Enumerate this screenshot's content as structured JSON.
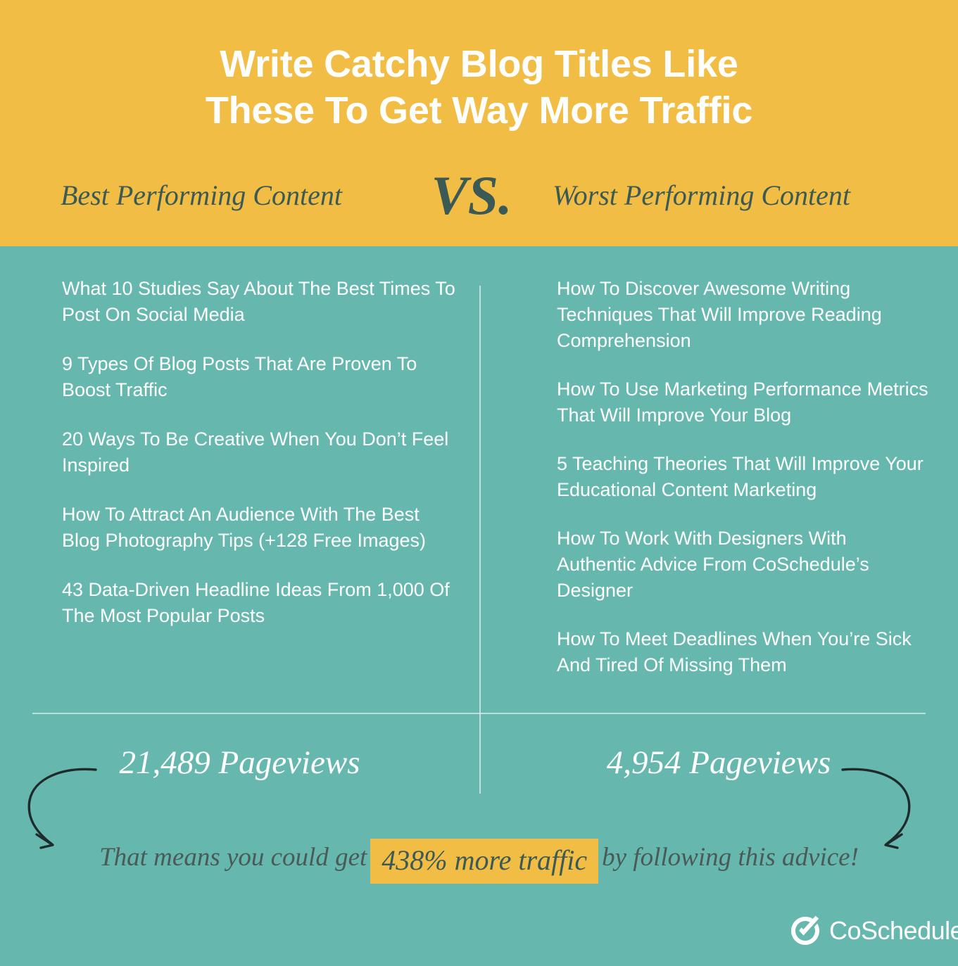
{
  "colors": {
    "header_bg": "#f2bd44",
    "body_bg": "#66b8ae",
    "title_text": "#ffffff",
    "accent_dark": "#3c5a55",
    "divider": "#ddeeeb",
    "highlight_bg": "#f2bd44",
    "statement_text": "#4a5a57",
    "arrow": "#1f2b2b"
  },
  "header": {
    "title_line1": "Write Catchy Blog Titles Like",
    "title_line2": "These To Get Way More Traffic",
    "left_label": "Best Performing Content",
    "vs_label": "VS.",
    "right_label": "Worst Performing Content"
  },
  "columns": {
    "best": {
      "items": [
        "What 10 Studies Say About The Best Times To Post On Social Media",
        "9 Types Of Blog Posts That Are Proven To Boost Traffic",
        "20 Ways To Be Creative When You Don’t Feel Inspired",
        "How To Attract An Audience With The Best Blog Photography Tips (+128 Free Images)",
        "43 Data-Driven Headline Ideas From 1,000 Of The Most Popular Posts"
      ],
      "pageviews": "21,489 Pageviews"
    },
    "worst": {
      "items": [
        "How To Discover Awesome Writing Techniques That Will Improve Reading Comprehension",
        "How To Use Marketing Performance Metrics That Will Improve Your Blog",
        "5 Teaching Theories That Will Improve Your Educational Content Marketing",
        "How To Work With Designers With Authentic Advice From CoSchedule’s Designer",
        "How To Meet Deadlines When You’re Sick And Tired Of Missing Them"
      ],
      "pageviews": "4,954 Pageviews"
    }
  },
  "statement": {
    "prefix": "That means you could get",
    "highlight": "438% more traffic",
    "suffix": "by following this advice!"
  },
  "footer": {
    "logo_text": "CoSchedule",
    "logo_icon": "check-circle-icon"
  },
  "chart_data": {
    "type": "bar",
    "title": "Write Catchy Blog Titles Like These To Get Way More Traffic",
    "categories": [
      "Best Performing Content",
      "Worst Performing Content"
    ],
    "values": [
      21489,
      4954
    ],
    "value_labels": [
      "21,489 Pageviews",
      "4,954 Pageviews"
    ],
    "xlabel": "",
    "ylabel": "Pageviews",
    "annotation": "That means you could get 438% more traffic by following this advice!",
    "ratio_percent": 438
  }
}
